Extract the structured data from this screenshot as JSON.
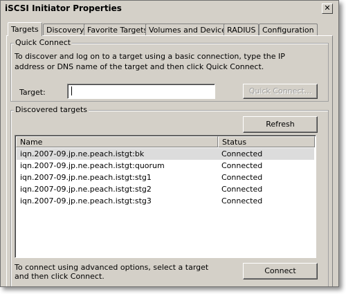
{
  "window": {
    "title": "iSCSI Initiator Properties"
  },
  "tabs": [
    {
      "label": "Targets"
    },
    {
      "label": "Discovery"
    },
    {
      "label": "Favorite Targets"
    },
    {
      "label": "Volumes and Devices"
    },
    {
      "label": "RADIUS"
    },
    {
      "label": "Configuration"
    }
  ],
  "quick_connect": {
    "title": "Quick Connect",
    "description": "To discover and log on to a target using a basic connection, type the IP address or DNS name of the target and then click Quick Connect.",
    "target_label": "Target:",
    "target_value": "",
    "button_label": "Quick Connect..."
  },
  "discovered": {
    "title": "Discovered targets",
    "refresh_label": "Refresh",
    "columns": {
      "name": "Name",
      "status": "Status"
    },
    "rows": [
      {
        "name": "iqn.2007-09.jp.ne.peach.istgt:bk",
        "status": "Connected"
      },
      {
        "name": "iqn.2007-09.jp.ne.peach.istgt:quorum",
        "status": "Connected"
      },
      {
        "name": "iqn.2007-09.jp.ne.peach.istgt:stg1",
        "status": "Connected"
      },
      {
        "name": "iqn.2007-09.jp.ne.peach.istgt:stg2",
        "status": "Connected"
      },
      {
        "name": "iqn.2007-09.jp.ne.peach.istgt:stg3",
        "status": "Connected"
      }
    ],
    "advanced_text": "To connect using advanced options, select a target and then click Connect.",
    "connect_label": "Connect"
  }
}
